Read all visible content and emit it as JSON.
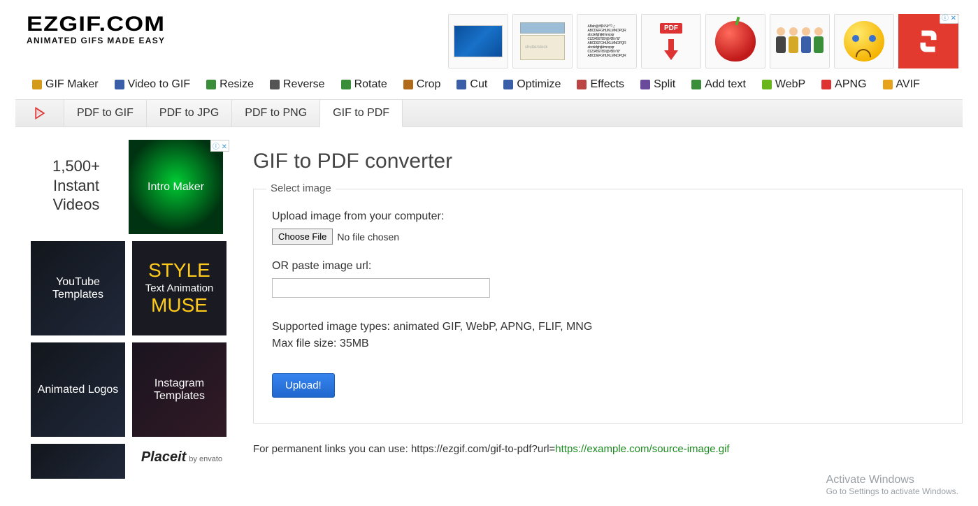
{
  "logo": {
    "main": "EZGIF.COM",
    "sub": "ANIMATED GIFS MADE EASY"
  },
  "nav": [
    {
      "label": "GIF Maker",
      "icon": "image-icon",
      "color": "#d49a1a"
    },
    {
      "label": "Video to GIF",
      "icon": "film-icon",
      "color": "#3a5ea8"
    },
    {
      "label": "Resize",
      "icon": "resize-icon",
      "color": "#3a8e3a"
    },
    {
      "label": "Reverse",
      "icon": "reverse-icon",
      "color": "#555"
    },
    {
      "label": "Rotate",
      "icon": "rotate-icon",
      "color": "#3a8e3a"
    },
    {
      "label": "Crop",
      "icon": "crop-icon",
      "color": "#b06a1a"
    },
    {
      "label": "Cut",
      "icon": "cut-icon",
      "color": "#3a5ea8"
    },
    {
      "label": "Optimize",
      "icon": "optimize-icon",
      "color": "#3a5ea8"
    },
    {
      "label": "Effects",
      "icon": "effects-icon",
      "color": "#b44"
    },
    {
      "label": "Split",
      "icon": "split-icon",
      "color": "#6a4a9a"
    },
    {
      "label": "Add text",
      "icon": "text-icon",
      "color": "#3a8e3a"
    },
    {
      "label": "WebP",
      "icon": "webp-icon",
      "color": "#6ab51a"
    },
    {
      "label": "APNG",
      "icon": "apng-icon",
      "color": "#d33"
    },
    {
      "label": "AVIF",
      "icon": "avif-icon",
      "color": "#e6a21a"
    }
  ],
  "subnav": {
    "items": [
      "PDF to GIF",
      "PDF to JPG",
      "PDF to PNG",
      "GIF to PDF"
    ],
    "active_index": 3
  },
  "sidebar_ad": {
    "headline": "1,500+ Instant Videos",
    "tiles": [
      "Intro Maker",
      "YouTube Templates",
      "Text Animation",
      "Animated Logos",
      "Instagram Templates"
    ],
    "brand": "Placeit",
    "brand_by": "by envato"
  },
  "page": {
    "title": "GIF to PDF converter"
  },
  "form": {
    "legend": "Select image",
    "upload_label": "Upload image from your computer:",
    "choose_file": "Choose File",
    "no_file": "No file chosen",
    "url_label": "OR paste image url:",
    "url_value": "",
    "supported": "Supported image types: animated GIF, WebP, APNG, FLIF, MNG",
    "max_size": "Max file size: 35MB",
    "submit": "Upload!"
  },
  "perma": {
    "prefix": "For permanent links you can use: https://ezgif.com/gif-to-pdf?url=",
    "example": "https://example.com/source-image.gif"
  },
  "watermark": {
    "line1": "Activate Windows",
    "line2": "Go to Settings to activate Windows."
  },
  "thumbs": [
    "blue-abstract",
    "id-card",
    "char-grid",
    "pdf-download",
    "apple",
    "people-group",
    "sad-emoji",
    "shutterstock-logo"
  ]
}
